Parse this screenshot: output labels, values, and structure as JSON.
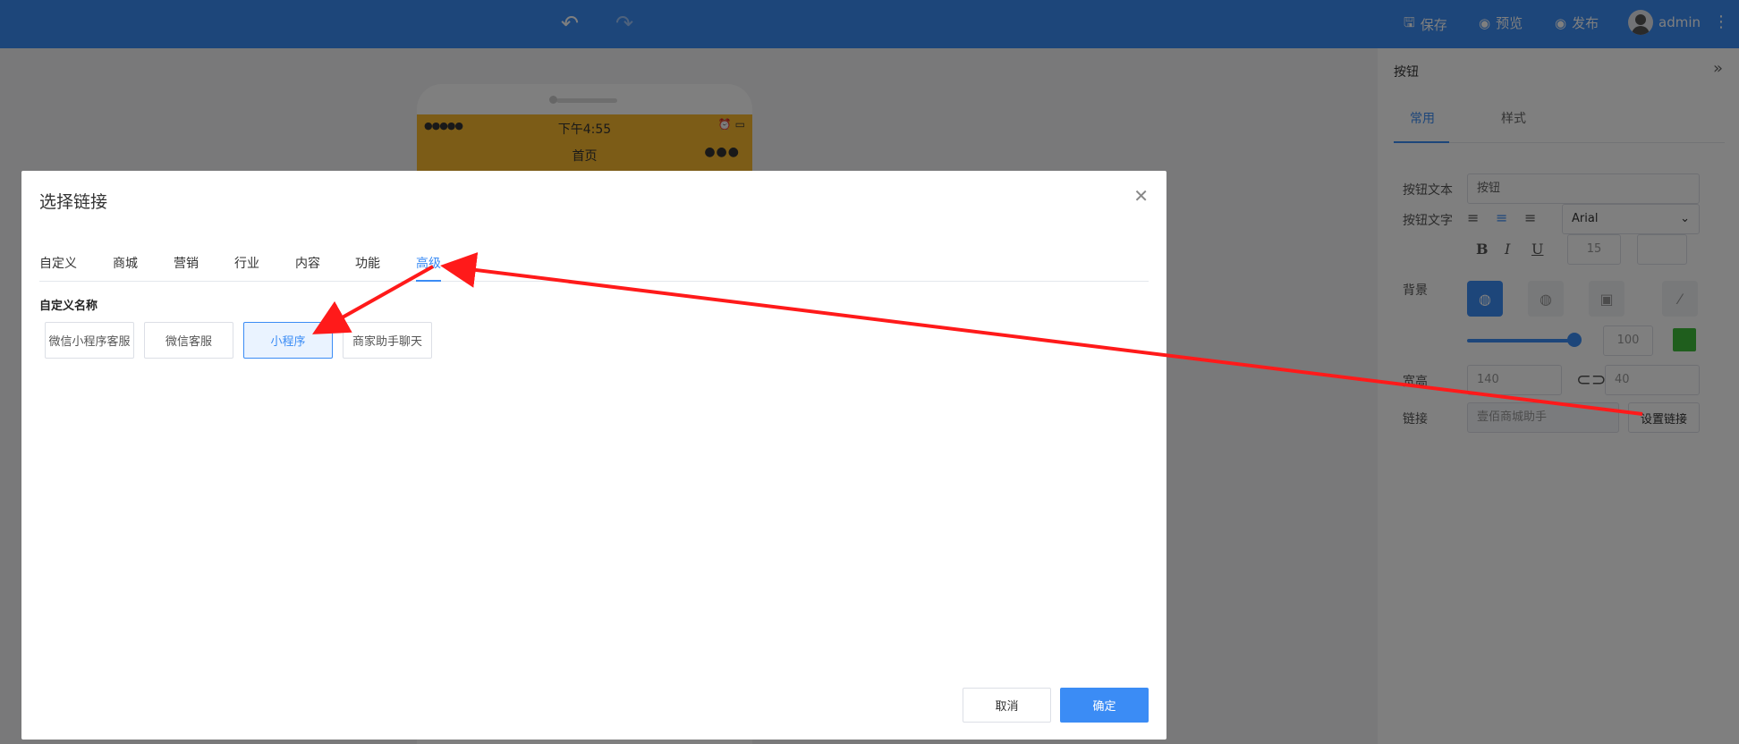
{
  "topbar": {
    "undo_icon": "undo-icon",
    "redo_icon": "redo-icon",
    "save_label": "保存",
    "preview_label": "预览",
    "publish_label": "发布",
    "user_name": "admin"
  },
  "phone": {
    "signal": "●●●●●",
    "time": "下午4:55",
    "page_title": "首页",
    "more": "●●●"
  },
  "right_panel": {
    "title": "按钮",
    "tabs": [
      "常用",
      "样式"
    ],
    "button_text_label": "按钮文本",
    "button_text_value": "按钮",
    "button_font_label": "按钮文字",
    "font_family": "Arial",
    "font_size": "15",
    "background_label": "背景",
    "opacity_value": "100",
    "size_label": "宽高",
    "width_value": "140",
    "height_value": "40",
    "link_label": "链接",
    "link_value": "壹佰商城助手",
    "set_link_label": "设置链接",
    "accent_color": "#3b8cf5",
    "swatch_color": "#3fbd3b"
  },
  "modal": {
    "title": "选择链接",
    "tabs": [
      {
        "label": "自定义"
      },
      {
        "label": "商城"
      },
      {
        "label": "营销"
      },
      {
        "label": "行业"
      },
      {
        "label": "内容"
      },
      {
        "label": "功能"
      },
      {
        "label": "高级"
      }
    ],
    "active_tab": "高级",
    "section_title": "自定义名称",
    "options": [
      {
        "label": "微信小程序客服"
      },
      {
        "label": "微信客服"
      },
      {
        "label": "小程序"
      },
      {
        "label": "商家助手聊天"
      }
    ],
    "selected_option": "小程序",
    "cancel_label": "取消",
    "confirm_label": "确定"
  }
}
